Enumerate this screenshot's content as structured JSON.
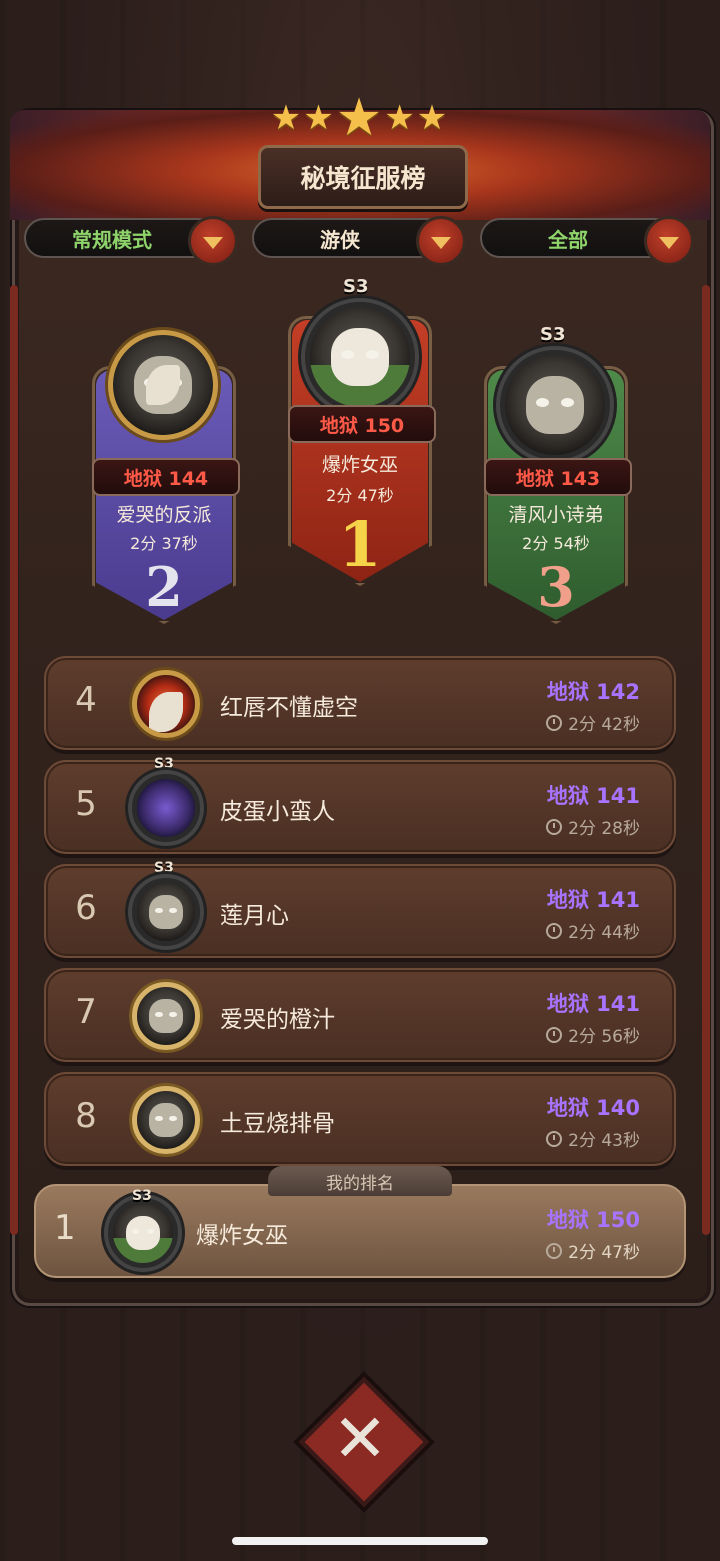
{
  "title": "秘境征服榜",
  "filters": [
    {
      "label": "常规模式"
    },
    {
      "label": "游侠"
    },
    {
      "label": "全部"
    }
  ],
  "podium": [
    {
      "rank": "2",
      "score": "地狱 144",
      "name": "爱哭的反派",
      "time": "2分 37秒",
      "badge": ""
    },
    {
      "rank": "1",
      "score": "地狱 150",
      "name": "爆炸女巫",
      "time": "2分 47秒",
      "badge": "S3"
    },
    {
      "rank": "3",
      "score": "地狱 143",
      "name": "清风小诗弟",
      "time": "2分 54秒",
      "badge": "S3"
    }
  ],
  "rows": [
    {
      "rank": "4",
      "name": "红唇不懂虚空",
      "score": "地狱 142",
      "time": "2分 42秒",
      "badge": ""
    },
    {
      "rank": "5",
      "name": "皮蛋小蛮人",
      "score": "地狱 141",
      "time": "2分 28秒",
      "badge": "S3"
    },
    {
      "rank": "6",
      "name": "莲月心",
      "score": "地狱 141",
      "time": "2分 44秒",
      "badge": "S3"
    },
    {
      "rank": "7",
      "name": "爱哭的橙汁",
      "score": "地狱 141",
      "time": "2分 56秒",
      "badge": ""
    },
    {
      "rank": "8",
      "name": "土豆烧排骨",
      "score": "地狱 140",
      "time": "2分 43秒",
      "badge": ""
    }
  ],
  "my_rank": {
    "label": "我的排名",
    "rank": "1",
    "name": "爆炸女巫",
    "score": "地狱 150",
    "time": "2分 47秒",
    "badge": "S3"
  },
  "icons": [
    "star-icon",
    "dropdown-arrow-icon",
    "clock-icon",
    "close-icon"
  ],
  "colors": {
    "score_purple": "#a874ff",
    "hell_red": "#ff5a48",
    "filter_green": "#8fd46b"
  }
}
